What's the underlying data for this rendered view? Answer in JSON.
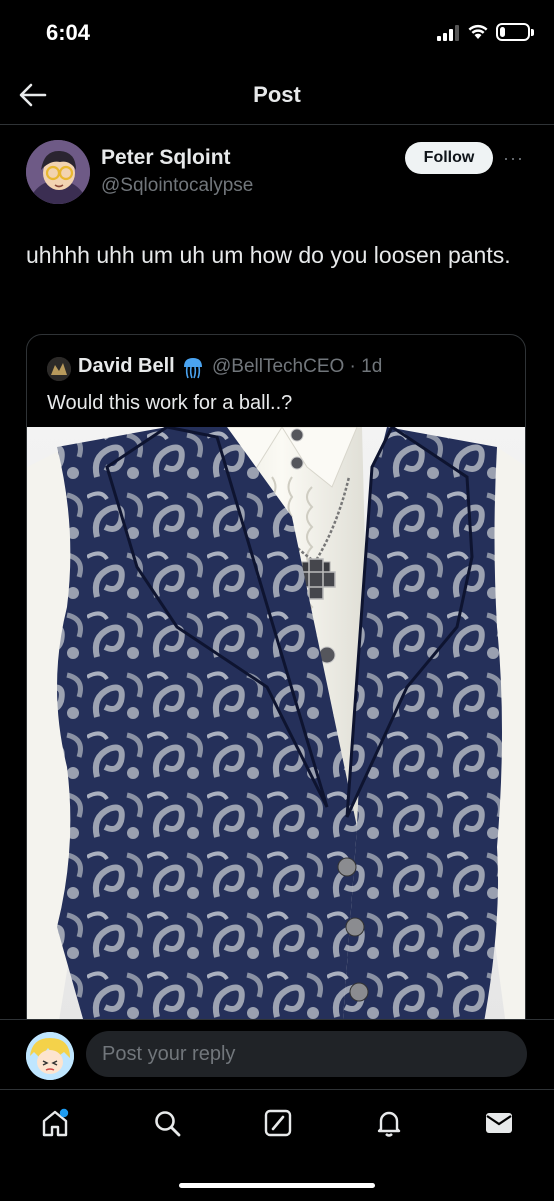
{
  "status_bar": {
    "time": "6:04",
    "battery_level": "19",
    "battery_fraction": 0.19
  },
  "header": {
    "title": "Post",
    "back_icon": "arrow-left-icon"
  },
  "post": {
    "author_name": "Peter Sqloint",
    "author_handle": "@Sqlointocalypse",
    "follow_label": "Follow",
    "more_label": "···",
    "text": "uhhhh uhh um uh um how do you loosen pants."
  },
  "quote": {
    "author_name": "David Bell",
    "author_handle": "@BellTechCEO · 1d",
    "text": "Would this work for a ball..?",
    "image_description": "vest-photo"
  },
  "reply": {
    "placeholder": "Post your reply"
  },
  "tab_bar": {
    "items": [
      "home-icon",
      "search-icon",
      "grok-icon",
      "notifications-icon",
      "messages-icon"
    ]
  },
  "colors": {
    "background": "#000000",
    "text": "#e7e9ea",
    "secondary_text": "#71767b",
    "border": "#2f3336",
    "accent": "#1d9bf0",
    "follow_bg": "#eff3f4"
  }
}
